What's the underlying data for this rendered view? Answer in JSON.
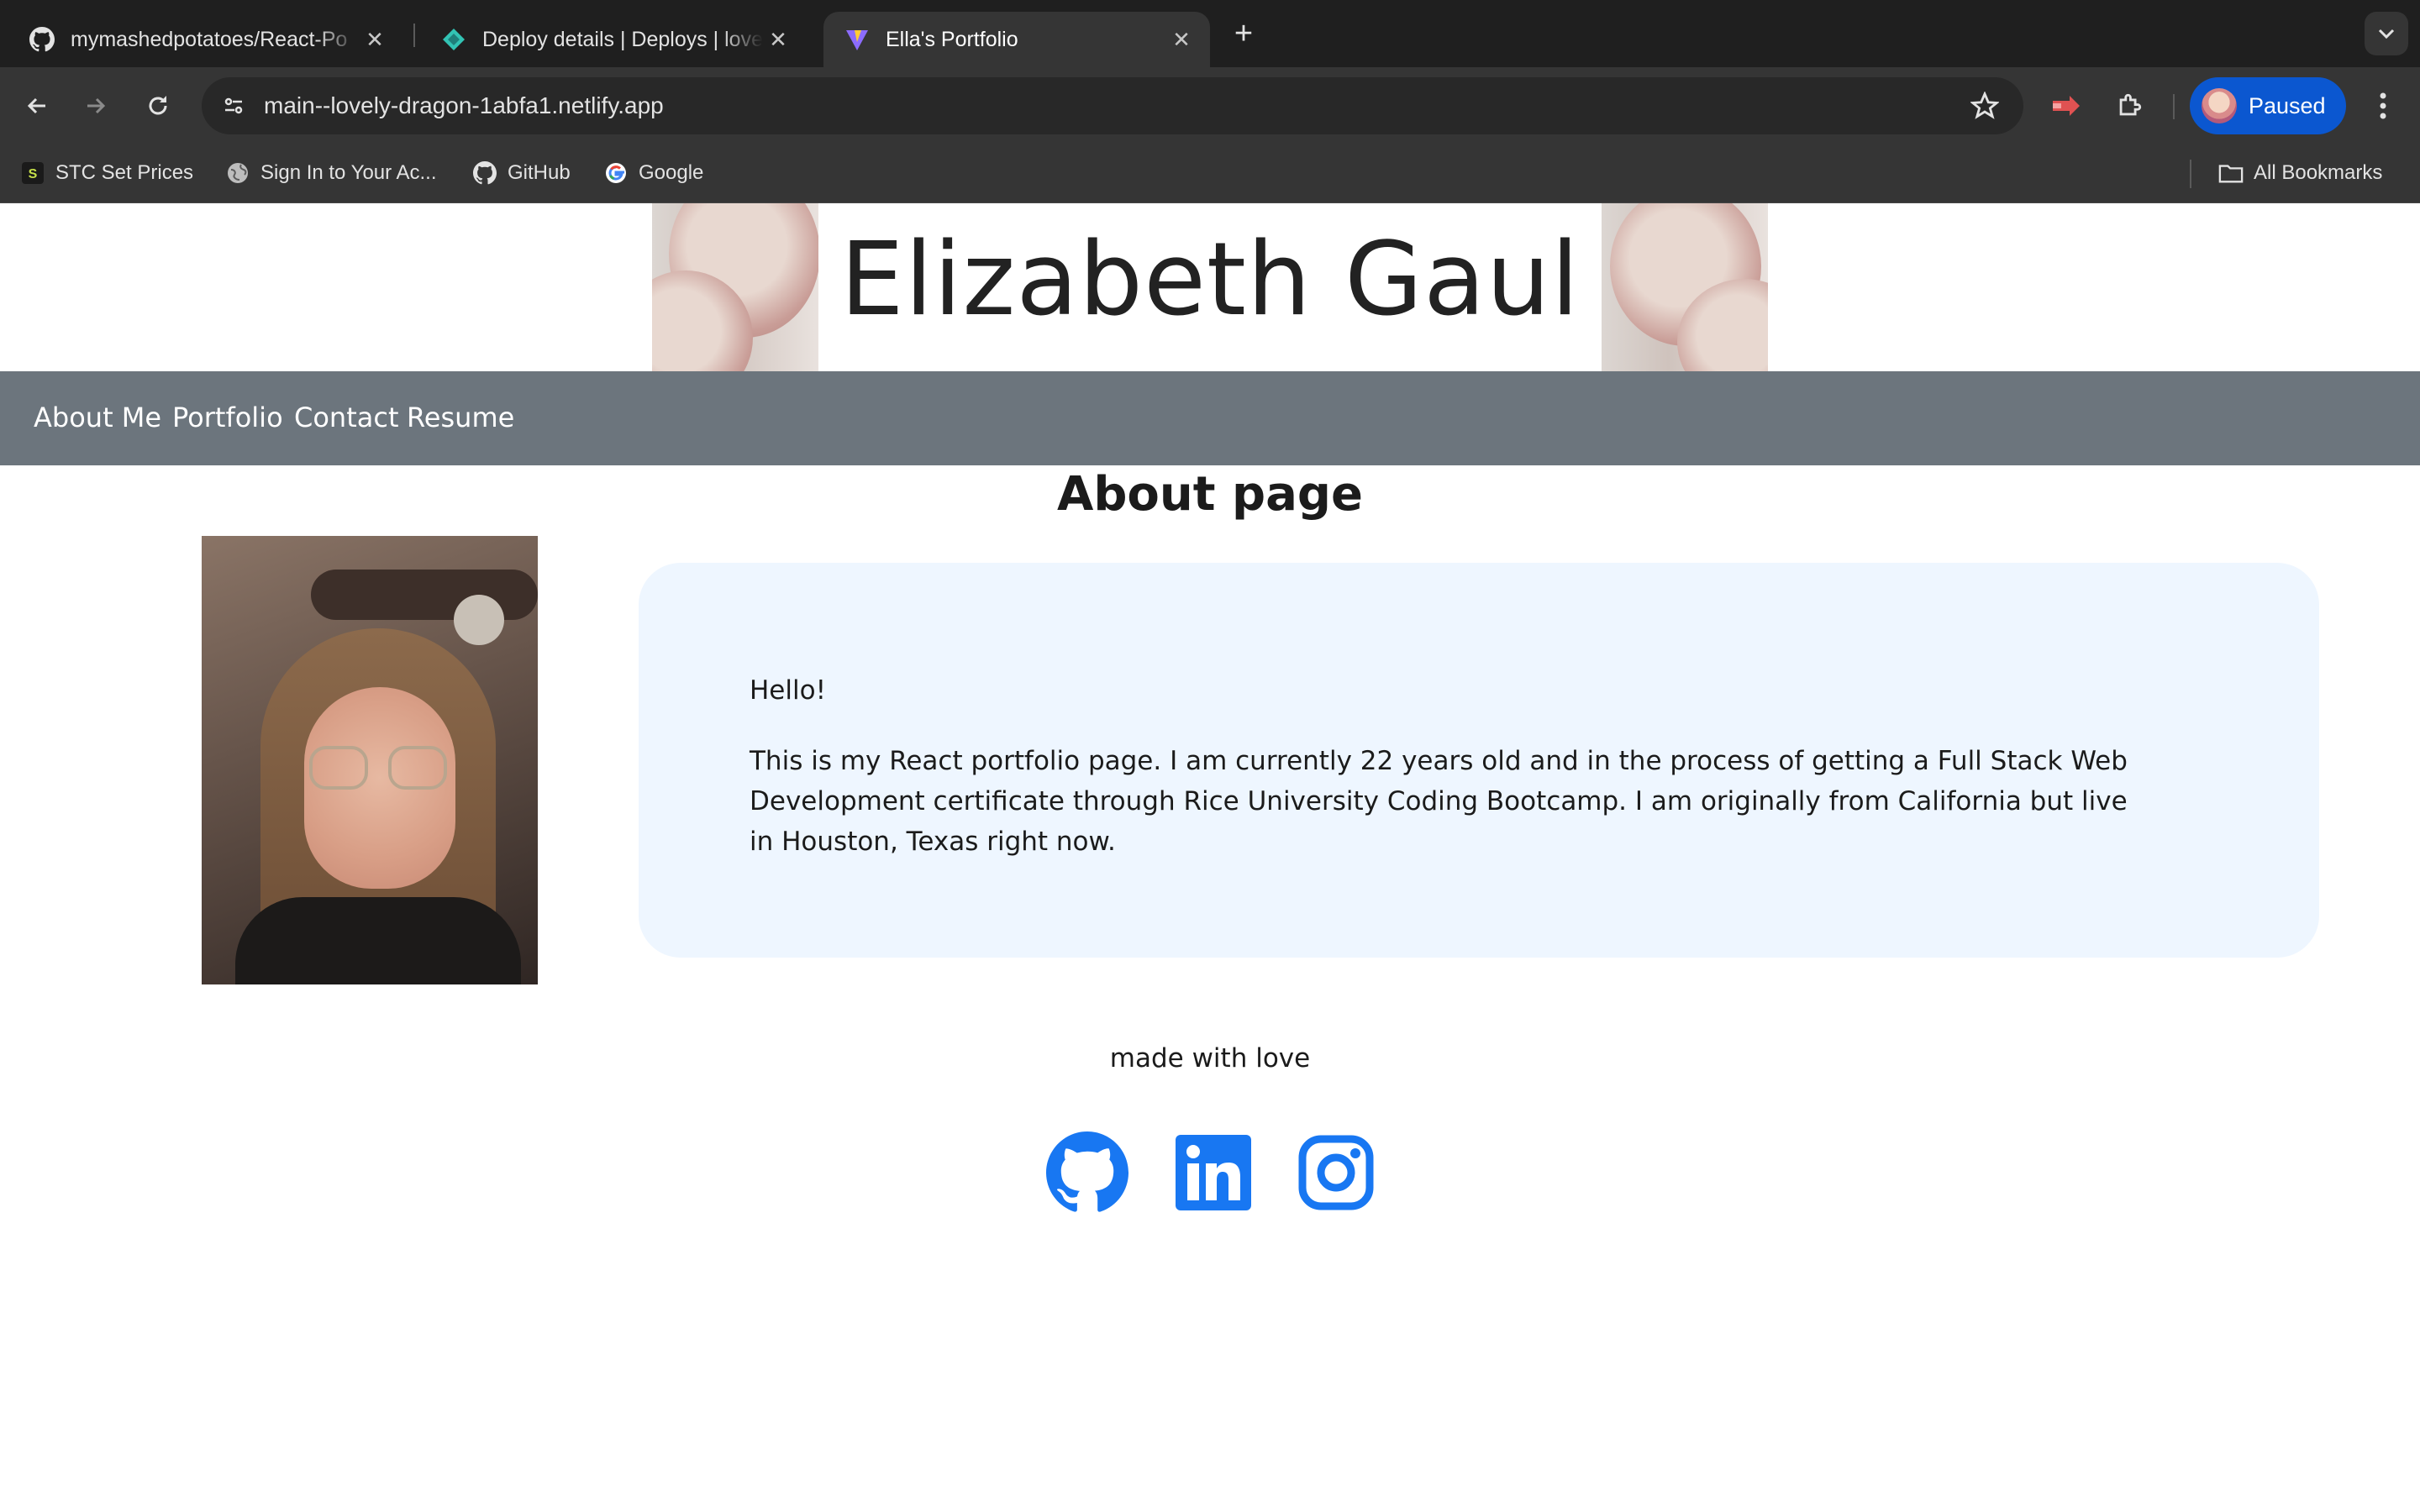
{
  "browser": {
    "tabs": [
      {
        "title": "mymashedpotatoes/React-Po",
        "icon": "github-icon",
        "active": false
      },
      {
        "title": "Deploy details | Deploys | love",
        "icon": "netlify-icon",
        "active": false
      },
      {
        "title": "Ella's Portfolio",
        "icon": "vite-icon",
        "active": true
      }
    ],
    "url": "main--lovely-dragon-1abfa1.netlify.app",
    "profile_label": "Paused",
    "bookmarks": [
      {
        "label": "STC Set Prices",
        "icon": "stc-icon"
      },
      {
        "label": "Sign In to Your Ac...",
        "icon": "globe-icon"
      },
      {
        "label": "GitHub",
        "icon": "github-icon"
      },
      {
        "label": "Google",
        "icon": "google-icon"
      }
    ],
    "all_bookmarks_label": "All Bookmarks"
  },
  "site": {
    "title": "Elizabeth Gaul",
    "nav": [
      "About Me",
      "Portfolio",
      "Contact",
      "Resume"
    ],
    "heading": "About page",
    "bio": {
      "greeting": "Hello!",
      "text": "This is my React portfolio page. I am currently 22 years old and in the process of getting a Full Stack Web Development certificate through Rice University Coding Bootcamp. I am originally from California but live in Houston, Texas right now."
    },
    "footer": {
      "text": "made with love",
      "social": [
        "github-icon",
        "linkedin-icon",
        "instagram-icon"
      ]
    },
    "colors": {
      "navbar": "#6c757d",
      "bio_card": "#eef6ff",
      "social_icons": "#1877f2"
    }
  }
}
